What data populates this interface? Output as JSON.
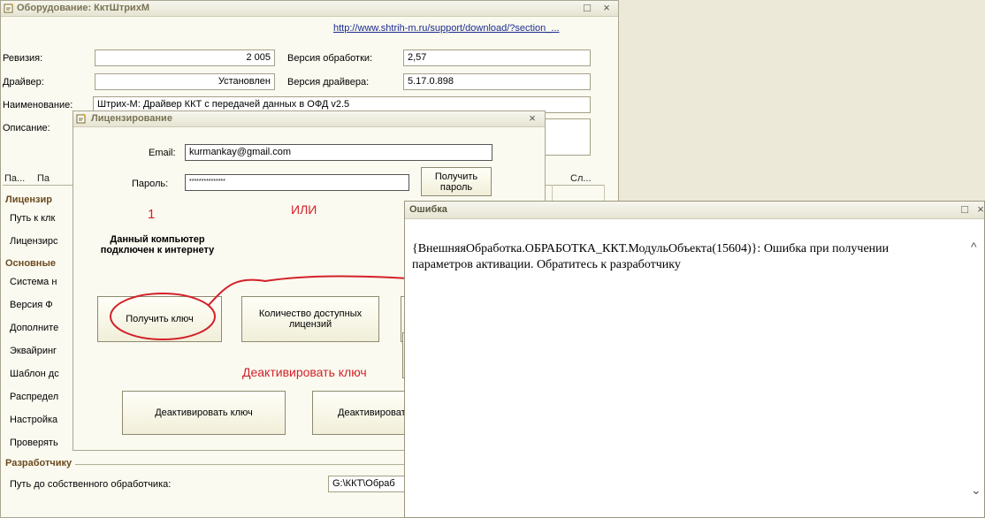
{
  "equipment_window": {
    "title": "Оборудование: КктШтрихМ",
    "link": "http://www.shtrih-m.ru/support/download/?section_...",
    "revision_label": "Ревизия:",
    "revision_value": "2 005",
    "processing_version_label": "Версия обработки:",
    "processing_version_value": "2,57",
    "driver_label": "Драйвер:",
    "driver_value": "Установлен",
    "driver_version_label": "Версия драйвера:",
    "driver_version_value": "5.17.0.898",
    "name_label": "Наименование:",
    "name_value": "Штрих-М: Драйвер ККТ с передачей данных в ОФД v2.5",
    "description_label": "Описание:",
    "tabs": [
      "Па...",
      "Па",
      "Сл..."
    ],
    "sections": {
      "licensing": "Лицензир",
      "main": "Основные",
      "developer": "Разработчику"
    },
    "left_items": [
      "Путь к клк",
      "Лицензирс",
      "Система н",
      "Версия Ф",
      "Дополните",
      "Эквайринг",
      "Шаблон дс",
      "Распредел",
      "Настройка",
      "Проверять"
    ],
    "own_handler_label": "Путь до собственного обработчика:",
    "own_handler_value": "G:\\ККТ\\Обраб"
  },
  "licensing_dialog": {
    "title": "Лицензирование",
    "email_label": "Email:",
    "email_value": "kurmankay@gmail.com",
    "password_label": "Пароль:",
    "password_value": "***************",
    "get_password_button": "Получить пароль",
    "annotation_one": "1",
    "annotation_or": "ИЛИ",
    "connected_text": "Данный компьютер подключен к интернету",
    "get_key_button": "Получить ключ",
    "available_licenses_button": "Количество доступных лицензий",
    "annotation_deactivate": "Деактивировать ключ",
    "deactivate_key_button": "Деактивировать ключ",
    "deactivate_key_button_2": "Деактивировать"
  },
  "error_dialog": {
    "title": "Ошибка",
    "message": "{ВнешняяОбработка.ОБРАБОТКА_ККТ.МодульОбъекта(15604)}: Ошибка при получении параметров активации. Обратитесь к разработчику"
  },
  "colors": {
    "annotation_red": "#d3212a",
    "group_title": "#6b4a1f",
    "link": "#1b2b8f"
  }
}
